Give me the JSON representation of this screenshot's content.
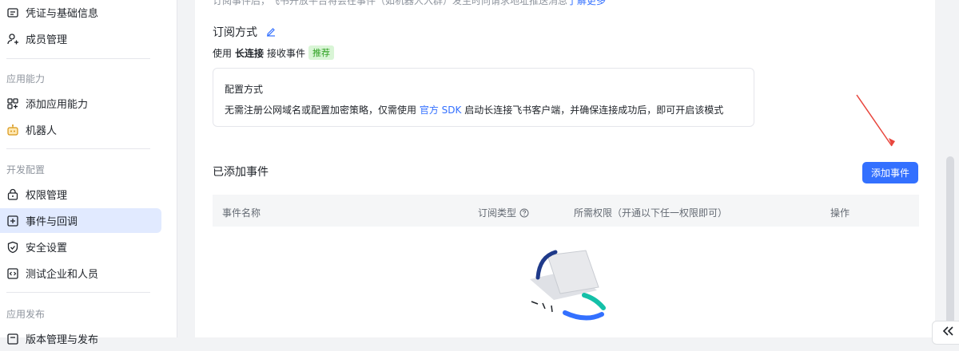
{
  "sidebar": {
    "items_top": [
      {
        "label": "凭证与基础信息",
        "icon": "credential-icon"
      },
      {
        "label": "成员管理",
        "icon": "member-add-icon"
      }
    ],
    "sections": [
      {
        "title": "应用能力",
        "items": [
          {
            "label": "添加应用能力",
            "icon": "grid-add-icon"
          },
          {
            "label": "机器人",
            "icon": "robot-icon"
          }
        ]
      },
      {
        "title": "开发配置",
        "items": [
          {
            "label": "权限管理",
            "icon": "lock-icon"
          },
          {
            "label": "事件与回调",
            "icon": "event-icon",
            "active": true
          },
          {
            "label": "安全设置",
            "icon": "shield-icon"
          },
          {
            "label": "测试企业和人员",
            "icon": "code-icon"
          }
        ]
      },
      {
        "title": "应用发布",
        "items": [
          {
            "label": "版本管理与发布",
            "icon": "version-icon"
          }
        ]
      }
    ]
  },
  "main": {
    "top_cut_text": "订阅事件后，飞书开放平台将会在事件（如机器人入群）发生时向请求地址推送消息",
    "top_cut_link": "了解更多",
    "subscribe": {
      "title": "订阅方式",
      "line_prefix": "使用",
      "line_bold": "长连接",
      "line_suffix": "接收事件",
      "tag": "推荐"
    },
    "config": {
      "title": "配置方式",
      "desc_before": "无需注册公网域名或配置加密策略，仅需使用",
      "desc_link": "官方 SDK",
      "desc_after": "启动长连接飞书客户端，并确保连接成功后，即可开启该模式"
    },
    "events": {
      "title": "已添加事件",
      "add_button": "添加事件",
      "columns": [
        "事件名称",
        "订阅类型",
        "所需权限（开通以下任一权限即可）",
        "操作"
      ]
    }
  },
  "colors": {
    "accent": "#3370ff",
    "active_bg": "#e1eaff",
    "tag_green": "#2ea121"
  }
}
